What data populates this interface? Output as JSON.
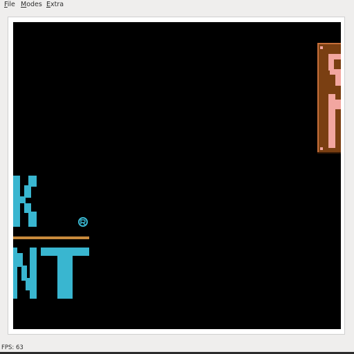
{
  "menubar": {
    "items": [
      {
        "mnemonic": "F",
        "rest": "ile"
      },
      {
        "mnemonic": "M",
        "rest": "odes"
      },
      {
        "mnemonic": "E",
        "rest": "xtra"
      }
    ]
  },
  "game": {
    "title_color": "#39b6d0",
    "underline_color": "#c88a3c",
    "sign_color": "#7a3f12",
    "sign_letter_color": "#f2a6a0",
    "background_color": "#000000"
  },
  "status": {
    "fps_text": "FPS: 63"
  }
}
